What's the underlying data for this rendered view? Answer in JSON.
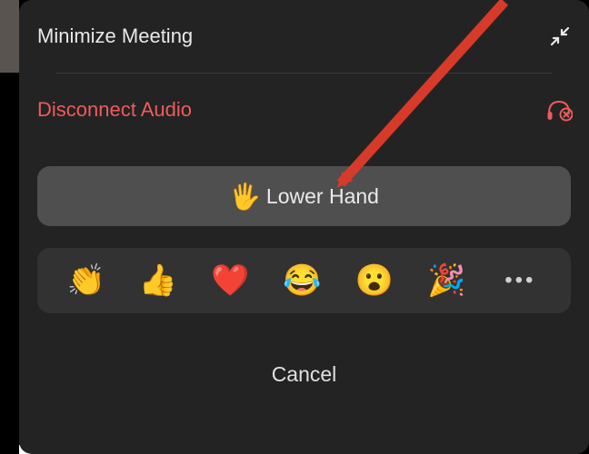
{
  "menu": {
    "minimize_label": "Minimize Meeting",
    "disconnect_label": "Disconnect Audio"
  },
  "lower_hand": {
    "emoji": "🖐",
    "label": "Lower Hand"
  },
  "reactions": {
    "clap": "👏",
    "thumbs_up": "👍",
    "heart": "❤️",
    "laugh": "😂",
    "wow": "😮",
    "tada": "🎉",
    "more": "•••"
  },
  "cancel_label": "Cancel",
  "colors": {
    "panel_bg": "#232323",
    "button_bg": "#4f4f4f",
    "reactions_bg": "#323232",
    "text_primary": "#e9e9e9",
    "text_danger": "#ef5b5b",
    "arrow": "#d83a2a"
  }
}
